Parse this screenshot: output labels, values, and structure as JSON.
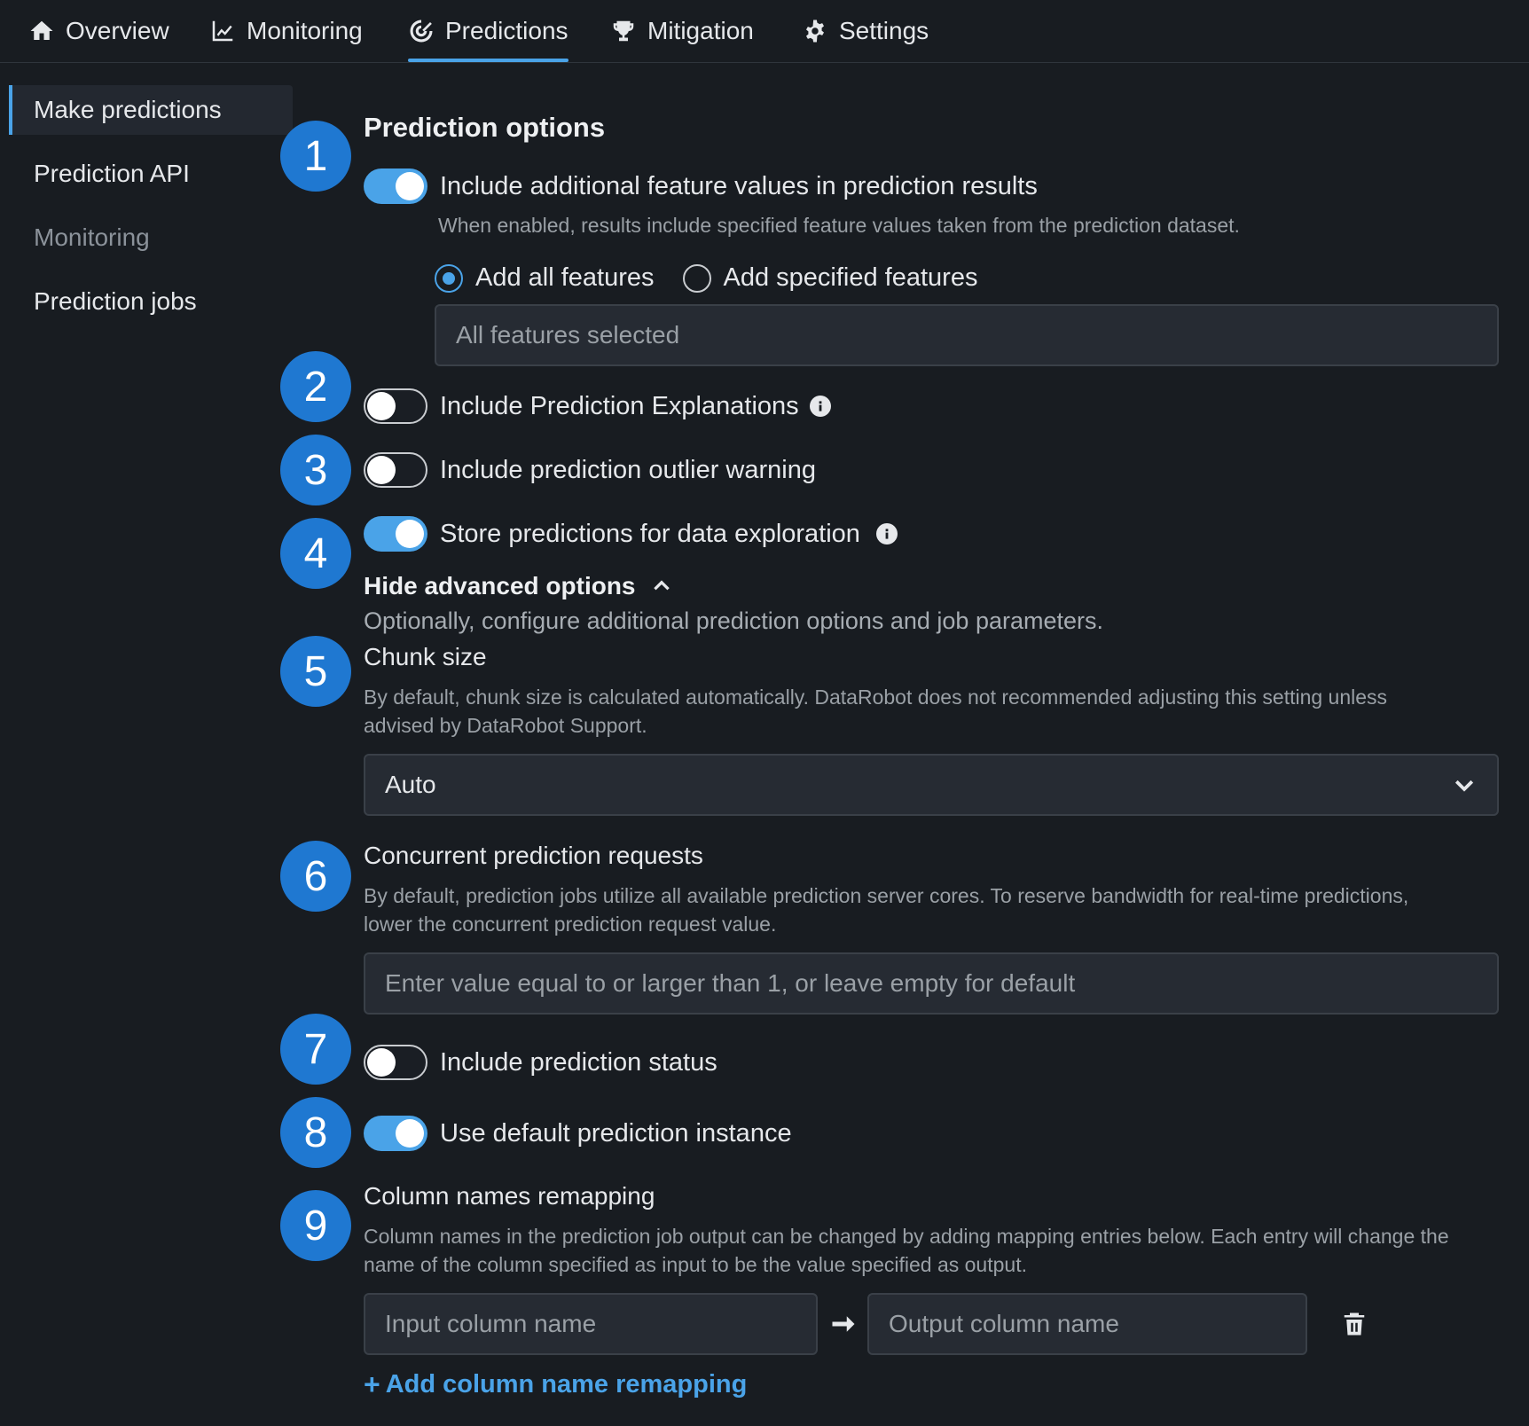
{
  "nav": {
    "tabs": [
      {
        "label": "Overview",
        "icon": "home-icon"
      },
      {
        "label": "Monitoring",
        "icon": "line-chart-icon"
      },
      {
        "label": "Predictions",
        "icon": "predictions-icon",
        "active": true
      },
      {
        "label": "Mitigation",
        "icon": "trophy-icon"
      },
      {
        "label": "Settings",
        "icon": "gear-icon"
      }
    ]
  },
  "sidebar": {
    "items": [
      {
        "label": "Make predictions",
        "active": true
      },
      {
        "label": "Prediction API"
      },
      {
        "label": "Monitoring",
        "muted": true
      },
      {
        "label": "Prediction jobs"
      }
    ]
  },
  "badges": [
    "1",
    "2",
    "3",
    "4",
    "5",
    "6",
    "7",
    "8",
    "9"
  ],
  "options": {
    "title": "Prediction options",
    "feature_values": {
      "label": "Include additional feature values in prediction results",
      "help": "When enabled, results include specified feature values taken from the prediction dataset.",
      "enabled": true,
      "radio_all": "Add all features",
      "radio_specified": "Add specified features",
      "selected": "all",
      "features_field": "All features selected"
    },
    "explanations": {
      "label": "Include Prediction Explanations",
      "enabled": false
    },
    "outlier": {
      "label": "Include prediction outlier warning",
      "enabled": false
    },
    "store": {
      "label": "Store predictions for data exploration",
      "enabled": true
    }
  },
  "advanced": {
    "toggle_label": "Hide advanced options",
    "description": "Optionally, configure additional prediction options and job parameters.",
    "chunk": {
      "title": "Chunk size",
      "help_line1": "By default, chunk size is calculated automatically. DataRobot does not recommended adjusting this setting unless",
      "help_line2": "advised by DataRobot Support.",
      "value": "Auto"
    },
    "concurrent": {
      "title": "Concurrent prediction requests",
      "help_line1": "By default, prediction jobs utilize all available prediction server cores. To reserve bandwidth for real-time predictions,",
      "help_line2": "lower the concurrent prediction request value.",
      "placeholder": "Enter value equal to or larger than 1, or leave empty for default"
    },
    "status": {
      "label": "Include prediction status",
      "enabled": false
    },
    "instance": {
      "label": "Use default prediction instance",
      "enabled": true
    },
    "remap": {
      "title": "Column names remapping",
      "help_line1": "Column names in the prediction job output can be changed by adding mapping entries below. Each entry will change the",
      "help_line2": "name of the column specified as input to be the value specified as output.",
      "input_placeholder": "Input column name",
      "output_placeholder": "Output column name",
      "add_label": "Add column name remapping"
    }
  },
  "colors": {
    "accent": "#4aa3e8",
    "badge": "#1f78d1",
    "background": "#181c21"
  }
}
